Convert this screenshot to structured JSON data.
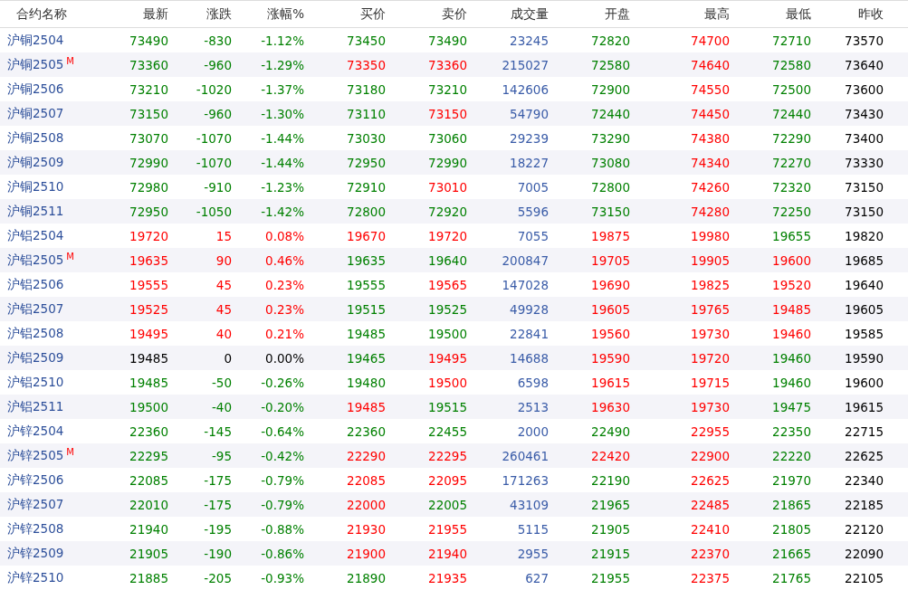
{
  "table": {
    "name_header": "合约名称",
    "columns": [
      "最新",
      "涨跌",
      "涨幅%",
      "买价",
      "卖价",
      "成交量",
      "开盘",
      "最高",
      "最低",
      "昨收"
    ],
    "rows": [
      {
        "name": "沪铜2504",
        "badge": "",
        "cells": [
          {
            "text": "73490",
            "color": "#008000"
          },
          {
            "text": "-830",
            "color": "#008000"
          },
          {
            "text": "-1.12%",
            "color": "#008000"
          },
          {
            "text": "73450",
            "color": "#008000"
          },
          {
            "text": "73490",
            "color": "#008000"
          },
          {
            "text": "23245",
            "color": "#3a5ca8"
          },
          {
            "text": "72820",
            "color": "#008000"
          },
          {
            "text": "74700",
            "color": "#ff0000"
          },
          {
            "text": "72710",
            "color": "#008000"
          },
          {
            "text": "73570",
            "color": "#000000"
          }
        ]
      },
      {
        "name": "沪铜2505",
        "badge": "M",
        "cells": [
          {
            "text": "73360",
            "color": "#008000"
          },
          {
            "text": "-960",
            "color": "#008000"
          },
          {
            "text": "-1.29%",
            "color": "#008000"
          },
          {
            "text": "73350",
            "color": "#ff0000"
          },
          {
            "text": "73360",
            "color": "#ff0000"
          },
          {
            "text": "215027",
            "color": "#3a5ca8"
          },
          {
            "text": "72580",
            "color": "#008000"
          },
          {
            "text": "74640",
            "color": "#ff0000"
          },
          {
            "text": "72580",
            "color": "#008000"
          },
          {
            "text": "73640",
            "color": "#000000"
          }
        ]
      },
      {
        "name": "沪铜2506",
        "badge": "",
        "cells": [
          {
            "text": "73210",
            "color": "#008000"
          },
          {
            "text": "-1020",
            "color": "#008000"
          },
          {
            "text": "-1.37%",
            "color": "#008000"
          },
          {
            "text": "73180",
            "color": "#008000"
          },
          {
            "text": "73210",
            "color": "#008000"
          },
          {
            "text": "142606",
            "color": "#3a5ca8"
          },
          {
            "text": "72900",
            "color": "#008000"
          },
          {
            "text": "74550",
            "color": "#ff0000"
          },
          {
            "text": "72500",
            "color": "#008000"
          },
          {
            "text": "73600",
            "color": "#000000"
          }
        ]
      },
      {
        "name": "沪铜2507",
        "badge": "",
        "cells": [
          {
            "text": "73150",
            "color": "#008000"
          },
          {
            "text": "-960",
            "color": "#008000"
          },
          {
            "text": "-1.30%",
            "color": "#008000"
          },
          {
            "text": "73110",
            "color": "#008000"
          },
          {
            "text": "73150",
            "color": "#ff0000"
          },
          {
            "text": "54790",
            "color": "#3a5ca8"
          },
          {
            "text": "72440",
            "color": "#008000"
          },
          {
            "text": "74450",
            "color": "#ff0000"
          },
          {
            "text": "72440",
            "color": "#008000"
          },
          {
            "text": "73430",
            "color": "#000000"
          }
        ]
      },
      {
        "name": "沪铜2508",
        "badge": "",
        "cells": [
          {
            "text": "73070",
            "color": "#008000"
          },
          {
            "text": "-1070",
            "color": "#008000"
          },
          {
            "text": "-1.44%",
            "color": "#008000"
          },
          {
            "text": "73030",
            "color": "#008000"
          },
          {
            "text": "73060",
            "color": "#008000"
          },
          {
            "text": "29239",
            "color": "#3a5ca8"
          },
          {
            "text": "73290",
            "color": "#008000"
          },
          {
            "text": "74380",
            "color": "#ff0000"
          },
          {
            "text": "72290",
            "color": "#008000"
          },
          {
            "text": "73400",
            "color": "#000000"
          }
        ]
      },
      {
        "name": "沪铜2509",
        "badge": "",
        "cells": [
          {
            "text": "72990",
            "color": "#008000"
          },
          {
            "text": "-1070",
            "color": "#008000"
          },
          {
            "text": "-1.44%",
            "color": "#008000"
          },
          {
            "text": "72950",
            "color": "#008000"
          },
          {
            "text": "72990",
            "color": "#008000"
          },
          {
            "text": "18227",
            "color": "#3a5ca8"
          },
          {
            "text": "73080",
            "color": "#008000"
          },
          {
            "text": "74340",
            "color": "#ff0000"
          },
          {
            "text": "72270",
            "color": "#008000"
          },
          {
            "text": "73330",
            "color": "#000000"
          }
        ]
      },
      {
        "name": "沪铜2510",
        "badge": "",
        "cells": [
          {
            "text": "72980",
            "color": "#008000"
          },
          {
            "text": "-910",
            "color": "#008000"
          },
          {
            "text": "-1.23%",
            "color": "#008000"
          },
          {
            "text": "72910",
            "color": "#008000"
          },
          {
            "text": "73010",
            "color": "#ff0000"
          },
          {
            "text": "7005",
            "color": "#3a5ca8"
          },
          {
            "text": "72800",
            "color": "#008000"
          },
          {
            "text": "74260",
            "color": "#ff0000"
          },
          {
            "text": "72320",
            "color": "#008000"
          },
          {
            "text": "73150",
            "color": "#000000"
          }
        ]
      },
      {
        "name": "沪铜2511",
        "badge": "",
        "cells": [
          {
            "text": "72950",
            "color": "#008000"
          },
          {
            "text": "-1050",
            "color": "#008000"
          },
          {
            "text": "-1.42%",
            "color": "#008000"
          },
          {
            "text": "72800",
            "color": "#008000"
          },
          {
            "text": "72920",
            "color": "#008000"
          },
          {
            "text": "5596",
            "color": "#3a5ca8"
          },
          {
            "text": "73150",
            "color": "#008000"
          },
          {
            "text": "74280",
            "color": "#ff0000"
          },
          {
            "text": "72250",
            "color": "#008000"
          },
          {
            "text": "73150",
            "color": "#000000"
          }
        ]
      },
      {
        "name": "沪铝2504",
        "badge": "",
        "cells": [
          {
            "text": "19720",
            "color": "#ff0000"
          },
          {
            "text": "15",
            "color": "#ff0000"
          },
          {
            "text": "0.08%",
            "color": "#ff0000"
          },
          {
            "text": "19670",
            "color": "#ff0000"
          },
          {
            "text": "19720",
            "color": "#ff0000"
          },
          {
            "text": "7055",
            "color": "#3a5ca8"
          },
          {
            "text": "19875",
            "color": "#ff0000"
          },
          {
            "text": "19980",
            "color": "#ff0000"
          },
          {
            "text": "19655",
            "color": "#008000"
          },
          {
            "text": "19820",
            "color": "#000000"
          }
        ]
      },
      {
        "name": "沪铝2505",
        "badge": "M",
        "cells": [
          {
            "text": "19635",
            "color": "#ff0000"
          },
          {
            "text": "90",
            "color": "#ff0000"
          },
          {
            "text": "0.46%",
            "color": "#ff0000"
          },
          {
            "text": "19635",
            "color": "#008000"
          },
          {
            "text": "19640",
            "color": "#008000"
          },
          {
            "text": "200847",
            "color": "#3a5ca8"
          },
          {
            "text": "19705",
            "color": "#ff0000"
          },
          {
            "text": "19905",
            "color": "#ff0000"
          },
          {
            "text": "19600",
            "color": "#ff0000"
          },
          {
            "text": "19685",
            "color": "#000000"
          }
        ]
      },
      {
        "name": "沪铝2506",
        "badge": "",
        "cells": [
          {
            "text": "19555",
            "color": "#ff0000"
          },
          {
            "text": "45",
            "color": "#ff0000"
          },
          {
            "text": "0.23%",
            "color": "#ff0000"
          },
          {
            "text": "19555",
            "color": "#008000"
          },
          {
            "text": "19565",
            "color": "#ff0000"
          },
          {
            "text": "147028",
            "color": "#3a5ca8"
          },
          {
            "text": "19690",
            "color": "#ff0000"
          },
          {
            "text": "19825",
            "color": "#ff0000"
          },
          {
            "text": "19520",
            "color": "#ff0000"
          },
          {
            "text": "19640",
            "color": "#000000"
          }
        ]
      },
      {
        "name": "沪铝2507",
        "badge": "",
        "cells": [
          {
            "text": "19525",
            "color": "#ff0000"
          },
          {
            "text": "45",
            "color": "#ff0000"
          },
          {
            "text": "0.23%",
            "color": "#ff0000"
          },
          {
            "text": "19515",
            "color": "#008000"
          },
          {
            "text": "19525",
            "color": "#008000"
          },
          {
            "text": "49928",
            "color": "#3a5ca8"
          },
          {
            "text": "19605",
            "color": "#ff0000"
          },
          {
            "text": "19765",
            "color": "#ff0000"
          },
          {
            "text": "19485",
            "color": "#ff0000"
          },
          {
            "text": "19605",
            "color": "#000000"
          }
        ]
      },
      {
        "name": "沪铝2508",
        "badge": "",
        "cells": [
          {
            "text": "19495",
            "color": "#ff0000"
          },
          {
            "text": "40",
            "color": "#ff0000"
          },
          {
            "text": "0.21%",
            "color": "#ff0000"
          },
          {
            "text": "19485",
            "color": "#008000"
          },
          {
            "text": "19500",
            "color": "#008000"
          },
          {
            "text": "22841",
            "color": "#3a5ca8"
          },
          {
            "text": "19560",
            "color": "#ff0000"
          },
          {
            "text": "19730",
            "color": "#ff0000"
          },
          {
            "text": "19460",
            "color": "#ff0000"
          },
          {
            "text": "19585",
            "color": "#000000"
          }
        ]
      },
      {
        "name": "沪铝2509",
        "badge": "",
        "cells": [
          {
            "text": "19485",
            "color": "#000000"
          },
          {
            "text": "0",
            "color": "#000000"
          },
          {
            "text": "0.00%",
            "color": "#000000"
          },
          {
            "text": "19465",
            "color": "#008000"
          },
          {
            "text": "19495",
            "color": "#ff0000"
          },
          {
            "text": "14688",
            "color": "#3a5ca8"
          },
          {
            "text": "19590",
            "color": "#ff0000"
          },
          {
            "text": "19720",
            "color": "#ff0000"
          },
          {
            "text": "19460",
            "color": "#008000"
          },
          {
            "text": "19590",
            "color": "#000000"
          }
        ]
      },
      {
        "name": "沪铝2510",
        "badge": "",
        "cells": [
          {
            "text": "19485",
            "color": "#008000"
          },
          {
            "text": "-50",
            "color": "#008000"
          },
          {
            "text": "-0.26%",
            "color": "#008000"
          },
          {
            "text": "19480",
            "color": "#008000"
          },
          {
            "text": "19500",
            "color": "#ff0000"
          },
          {
            "text": "6598",
            "color": "#3a5ca8"
          },
          {
            "text": "19615",
            "color": "#ff0000"
          },
          {
            "text": "19715",
            "color": "#ff0000"
          },
          {
            "text": "19460",
            "color": "#008000"
          },
          {
            "text": "19600",
            "color": "#000000"
          }
        ]
      },
      {
        "name": "沪铝2511",
        "badge": "",
        "cells": [
          {
            "text": "19500",
            "color": "#008000"
          },
          {
            "text": "-40",
            "color": "#008000"
          },
          {
            "text": "-0.20%",
            "color": "#008000"
          },
          {
            "text": "19485",
            "color": "#ff0000"
          },
          {
            "text": "19515",
            "color": "#008000"
          },
          {
            "text": "2513",
            "color": "#3a5ca8"
          },
          {
            "text": "19630",
            "color": "#ff0000"
          },
          {
            "text": "19730",
            "color": "#ff0000"
          },
          {
            "text": "19475",
            "color": "#008000"
          },
          {
            "text": "19615",
            "color": "#000000"
          }
        ]
      },
      {
        "name": "沪锌2504",
        "badge": "",
        "cells": [
          {
            "text": "22360",
            "color": "#008000"
          },
          {
            "text": "-145",
            "color": "#008000"
          },
          {
            "text": "-0.64%",
            "color": "#008000"
          },
          {
            "text": "22360",
            "color": "#008000"
          },
          {
            "text": "22455",
            "color": "#008000"
          },
          {
            "text": "2000",
            "color": "#3a5ca8"
          },
          {
            "text": "22490",
            "color": "#008000"
          },
          {
            "text": "22955",
            "color": "#ff0000"
          },
          {
            "text": "22350",
            "color": "#008000"
          },
          {
            "text": "22715",
            "color": "#000000"
          }
        ]
      },
      {
        "name": "沪锌2505",
        "badge": "M",
        "cells": [
          {
            "text": "22295",
            "color": "#008000"
          },
          {
            "text": "-95",
            "color": "#008000"
          },
          {
            "text": "-0.42%",
            "color": "#008000"
          },
          {
            "text": "22290",
            "color": "#ff0000"
          },
          {
            "text": "22295",
            "color": "#ff0000"
          },
          {
            "text": "260461",
            "color": "#3a5ca8"
          },
          {
            "text": "22420",
            "color": "#ff0000"
          },
          {
            "text": "22900",
            "color": "#ff0000"
          },
          {
            "text": "22220",
            "color": "#008000"
          },
          {
            "text": "22625",
            "color": "#000000"
          }
        ]
      },
      {
        "name": "沪锌2506",
        "badge": "",
        "cells": [
          {
            "text": "22085",
            "color": "#008000"
          },
          {
            "text": "-175",
            "color": "#008000"
          },
          {
            "text": "-0.79%",
            "color": "#008000"
          },
          {
            "text": "22085",
            "color": "#ff0000"
          },
          {
            "text": "22095",
            "color": "#ff0000"
          },
          {
            "text": "171263",
            "color": "#3a5ca8"
          },
          {
            "text": "22190",
            "color": "#008000"
          },
          {
            "text": "22625",
            "color": "#ff0000"
          },
          {
            "text": "21970",
            "color": "#008000"
          },
          {
            "text": "22340",
            "color": "#000000"
          }
        ]
      },
      {
        "name": "沪锌2507",
        "badge": "",
        "cells": [
          {
            "text": "22010",
            "color": "#008000"
          },
          {
            "text": "-175",
            "color": "#008000"
          },
          {
            "text": "-0.79%",
            "color": "#008000"
          },
          {
            "text": "22000",
            "color": "#ff0000"
          },
          {
            "text": "22005",
            "color": "#008000"
          },
          {
            "text": "43109",
            "color": "#3a5ca8"
          },
          {
            "text": "21965",
            "color": "#008000"
          },
          {
            "text": "22485",
            "color": "#ff0000"
          },
          {
            "text": "21865",
            "color": "#008000"
          },
          {
            "text": "22185",
            "color": "#000000"
          }
        ]
      },
      {
        "name": "沪锌2508",
        "badge": "",
        "cells": [
          {
            "text": "21940",
            "color": "#008000"
          },
          {
            "text": "-195",
            "color": "#008000"
          },
          {
            "text": "-0.88%",
            "color": "#008000"
          },
          {
            "text": "21930",
            "color": "#ff0000"
          },
          {
            "text": "21955",
            "color": "#ff0000"
          },
          {
            "text": "5115",
            "color": "#3a5ca8"
          },
          {
            "text": "21905",
            "color": "#008000"
          },
          {
            "text": "22410",
            "color": "#ff0000"
          },
          {
            "text": "21805",
            "color": "#008000"
          },
          {
            "text": "22120",
            "color": "#000000"
          }
        ]
      },
      {
        "name": "沪锌2509",
        "badge": "",
        "cells": [
          {
            "text": "21905",
            "color": "#008000"
          },
          {
            "text": "-190",
            "color": "#008000"
          },
          {
            "text": "-0.86%",
            "color": "#008000"
          },
          {
            "text": "21900",
            "color": "#ff0000"
          },
          {
            "text": "21940",
            "color": "#ff0000"
          },
          {
            "text": "2955",
            "color": "#3a5ca8"
          },
          {
            "text": "21915",
            "color": "#008000"
          },
          {
            "text": "22370",
            "color": "#ff0000"
          },
          {
            "text": "21665",
            "color": "#008000"
          },
          {
            "text": "22090",
            "color": "#000000"
          }
        ]
      },
      {
        "name": "沪锌2510",
        "badge": "",
        "cells": [
          {
            "text": "21885",
            "color": "#008000"
          },
          {
            "text": "-205",
            "color": "#008000"
          },
          {
            "text": "-0.93%",
            "color": "#008000"
          },
          {
            "text": "21890",
            "color": "#008000"
          },
          {
            "text": "21935",
            "color": "#ff0000"
          },
          {
            "text": "627",
            "color": "#3a5ca8"
          },
          {
            "text": "21955",
            "color": "#008000"
          },
          {
            "text": "22375",
            "color": "#ff0000"
          },
          {
            "text": "21765",
            "color": "#008000"
          },
          {
            "text": "22105",
            "color": "#000000"
          }
        ]
      }
    ]
  }
}
